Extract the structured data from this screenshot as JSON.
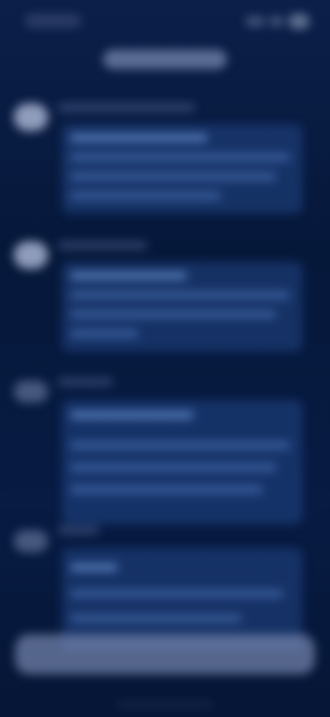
{
  "status_bar": {
    "time": "",
    "icons": [
      "signal-icon",
      "wifi-icon",
      "battery-icon"
    ]
  },
  "header": {
    "title": ""
  },
  "messages": [
    {
      "sender": "",
      "lines": [
        "",
        "",
        "",
        ""
      ]
    },
    {
      "sender": "",
      "lines": [
        "",
        "",
        "",
        ""
      ]
    },
    {
      "sender": "",
      "lines": [
        "",
        "",
        "",
        ""
      ]
    },
    {
      "sender": "",
      "lines": [
        "",
        "",
        ""
      ]
    }
  ],
  "composer": {
    "placeholder": ""
  },
  "colors": {
    "background": "#081a3d",
    "bubble": "#28509a",
    "composer": "#7887af"
  }
}
